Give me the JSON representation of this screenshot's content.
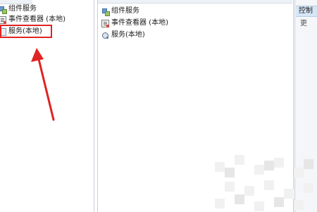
{
  "left_tree": {
    "items": [
      {
        "label": "组件服务",
        "icon": "component-services-icon"
      },
      {
        "label": "事件查看器 (本地)",
        "icon": "event-viewer-icon"
      },
      {
        "label": "服务(本地)",
        "icon": "services-icon",
        "highlighted": true
      }
    ]
  },
  "middle_list": {
    "items": [
      {
        "label": "组件服务",
        "icon": "component-services-icon"
      },
      {
        "label": "事件查看器 (本地)",
        "icon": "event-viewer-icon"
      },
      {
        "label": "服务(本地)",
        "icon": "services-icon"
      }
    ]
  },
  "right_panel": {
    "header": "控制台",
    "sub": "更"
  },
  "annotation": {
    "highlight_color": "#e02424",
    "arrow_color": "#e02424"
  }
}
